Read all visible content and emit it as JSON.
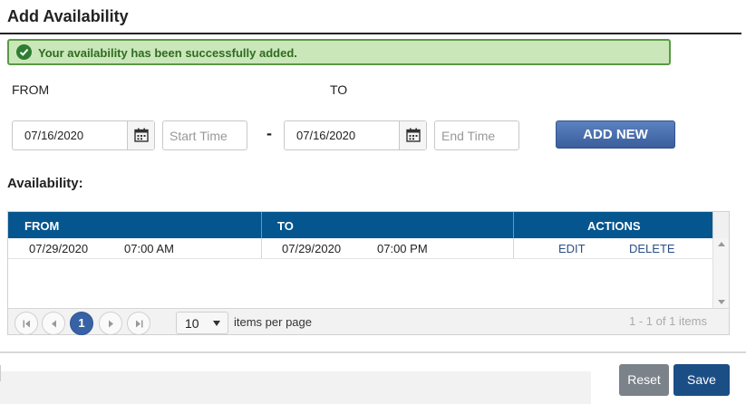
{
  "page": {
    "title": "Add Availability"
  },
  "alert": {
    "message": "Your availability has been successfully added.",
    "icon": "check-circle-icon",
    "color": "#c9e7b8"
  },
  "form": {
    "from_label": "FROM",
    "to_label": "TO",
    "from_date": "07/16/2020",
    "start_time_placeholder": "Start Time",
    "separator": "-",
    "to_date": "07/16/2020",
    "end_time_placeholder": "End Time",
    "add_button": "ADD NEW"
  },
  "availability": {
    "label": "Availability:",
    "columns": [
      "FROM",
      "TO",
      "ACTIONS"
    ],
    "rows": [
      {
        "from_date": "07/29/2020",
        "from_time": "07:00 AM",
        "to_date": "07/29/2020",
        "to_time": "07:00 PM",
        "edit": "EDIT",
        "delete": "DELETE"
      }
    ],
    "header_color": "#05558f"
  },
  "pager": {
    "current_page": "1",
    "page_size": "10",
    "page_size_label": "items per page",
    "info": "1 - 1 of 1 items"
  },
  "footer": {
    "reset_label": "Reset",
    "save_label": "Save"
  }
}
